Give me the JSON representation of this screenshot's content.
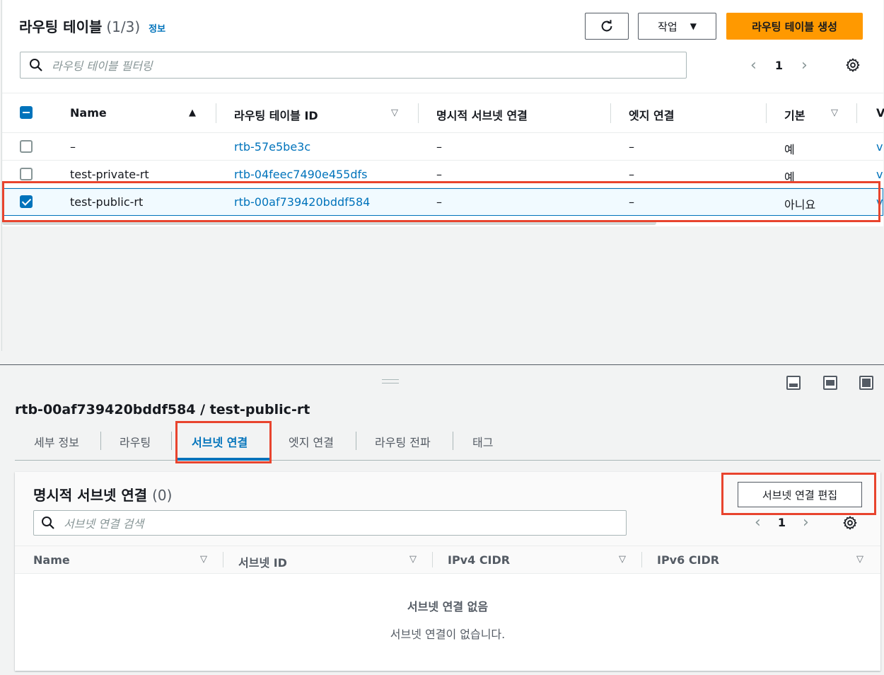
{
  "top": {
    "title": "라우팅 테이블",
    "count": "(1/3)",
    "info_link": "정보",
    "actions_label": "작업",
    "create_label": "라우팅 테이블 생성",
    "search_placeholder": "라우팅 테이블 필터링",
    "page": "1",
    "columns": [
      "Name",
      "라우팅 테이블 ID",
      "명시적 서브넷 연결",
      "엣지 연결",
      "기본",
      "V"
    ],
    "rows": [
      {
        "name": "–",
        "id": "rtb-57e5be3c",
        "explicit": "–",
        "edge": "–",
        "main": "예",
        "extra": "v",
        "selected": false
      },
      {
        "name": "test-private-rt",
        "id": "rtb-04feec7490e455dfs",
        "explicit": "–",
        "edge": "–",
        "main": "예",
        "extra": "v",
        "selected": false
      },
      {
        "name": "test-public-rt",
        "id": "rtb-00af739420bddf584",
        "explicit": "–",
        "edge": "–",
        "main": "아니요",
        "extra": "v",
        "selected": true
      }
    ]
  },
  "detail": {
    "title": "rtb-00af739420bddf584 / test-public-rt",
    "tabs": [
      "세부 정보",
      "라우팅",
      "서브넷 연결",
      "엣지 연결",
      "라우팅 전파",
      "태그"
    ],
    "active_tab": "서브넷 연결",
    "card": {
      "title": "명시적 서브넷 연결",
      "count": "(0)",
      "edit_label": "서브넷 연결 편집",
      "search_placeholder": "서브넷 연결 검색",
      "page": "1",
      "columns": [
        "Name",
        "서브넷 ID",
        "IPv4 CIDR",
        "IPv6 CIDR"
      ],
      "empty_title": "서브넷 연결 없음",
      "empty_desc": "서브넷 연결이 없습니다."
    }
  },
  "colors": {
    "accent": "#0073bb",
    "primary_button": "#ff9900",
    "highlight": "#e8442e"
  }
}
